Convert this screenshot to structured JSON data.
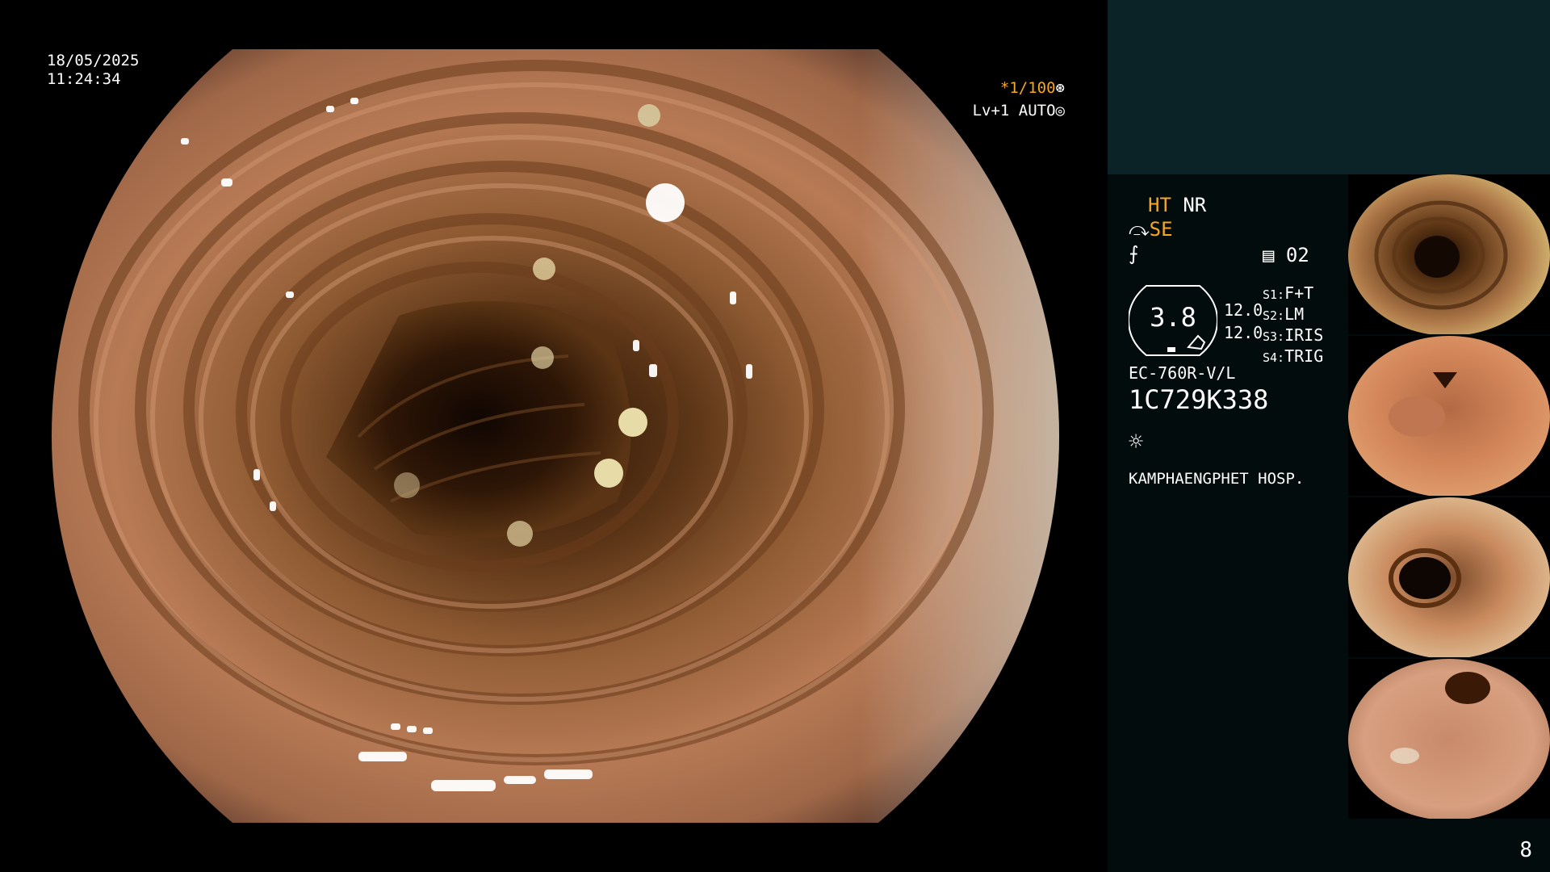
{
  "overlay": {
    "date": "18/05/2025",
    "time": "11:24:34",
    "shutter": "*1/100",
    "level": "Lv+1 AUTO"
  },
  "info": {
    "ht": "HT",
    "nr": "NR",
    "se": "SE",
    "counter": "02",
    "gauge_value": "3.8",
    "val_1": "12.0",
    "val_2": "12.0",
    "s1_key": "S1:",
    "s1_value": "F+T",
    "s2_key": "S2:",
    "s2_value": "LM",
    "s3_key": "S3:",
    "s3_value": "IRIS",
    "s4_key": "S4:",
    "s4_value": "TRIG",
    "scope_model": "EC-760R-V/L",
    "scope_serial": "1C729K338",
    "hospital": "KAMPHAENGPHET HOSP."
  },
  "page_number": "8",
  "colors": {
    "accent": "#f5a623",
    "panel": "#030c0c",
    "band": "#0b2226"
  }
}
